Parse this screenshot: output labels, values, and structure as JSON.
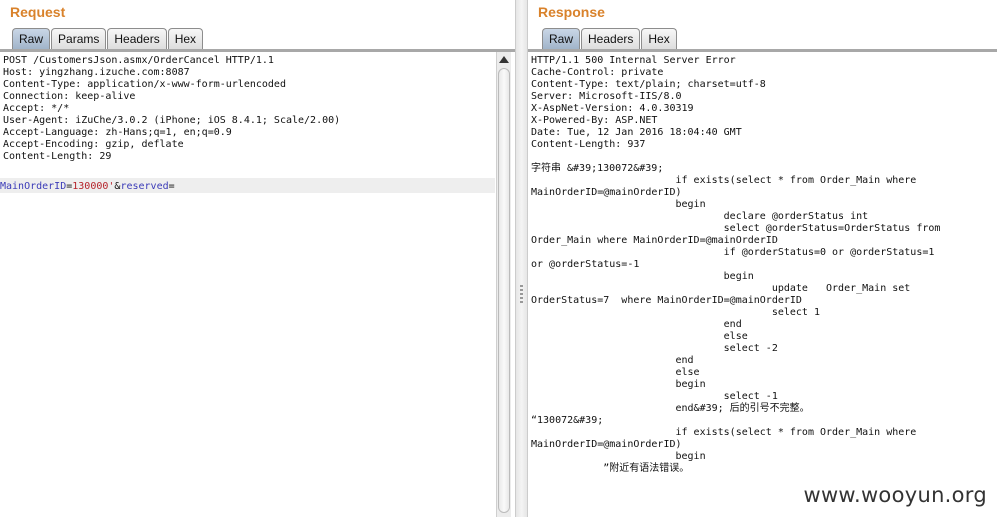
{
  "request": {
    "title": "Request",
    "tabs": [
      "Raw",
      "Params",
      "Headers",
      "Hex"
    ],
    "active_tab": "Raw",
    "headers_text": "POST /CustomersJson.asmx/OrderCancel HTTP/1.1\nHost: yingzhang.izuche.com:8087\nContent-Type: application/x-www-form-urlencoded\nConnection: keep-alive\nAccept: */*\nUser-Agent: iZuChe/3.0.2 (iPhone; iOS 8.4.1; Scale/2.00)\nAccept-Language: zh-Hans;q=1, en;q=0.9\nAccept-Encoding: gzip, deflate\nContent-Length: 29",
    "body": {
      "param1_name": "MainOrderID",
      "eq1": "=",
      "param1_value": "130000'",
      "amp": "&",
      "param2_name": "reserved",
      "eq2": "="
    }
  },
  "response": {
    "title": "Response",
    "tabs": [
      "Raw",
      "Headers",
      "Hex"
    ],
    "active_tab": "Raw",
    "text": "HTTP/1.1 500 Internal Server Error\nCache-Control: private\nContent-Type: text/plain; charset=utf-8\nServer: Microsoft-IIS/8.0\nX-AspNet-Version: 4.0.30319\nX-Powered-By: ASP.NET\nDate: Tue, 12 Jan 2016 18:04:40 GMT\nContent-Length: 937\n\n字符串 &#39;130072&#39;\n                        if exists(select * from Order_Main where\nMainOrderID=@mainOrderID)\n                        begin\n                                declare @orderStatus int\n                                select @orderStatus=OrderStatus from\nOrder_Main where MainOrderID=@mainOrderID\n                                if @orderStatus=0 or @orderStatus=1\nor @orderStatus=-1\n                                begin\n                                        update   Order_Main set\nOrderStatus=7  where MainOrderID=@mainOrderID\n                                        select 1\n                                end\n                                else\n                                select -2\n                        end\n                        else\n                        begin\n                                select -1\n                        end&#39; 后的引号不完整。\n“130072&#39;\n                        if exists(select * from Order_Main where\nMainOrderID=@mainOrderID)\n                        begin\n            ”附近有语法错误。"
  },
  "watermark": "www.wooyun.org"
}
